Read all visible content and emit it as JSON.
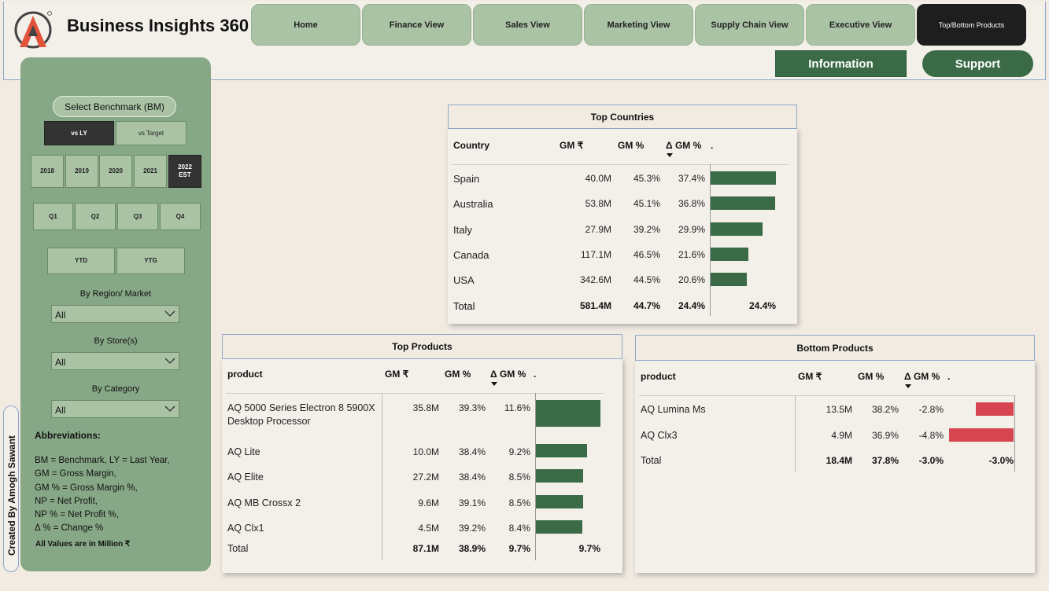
{
  "app": {
    "title": "Business Insights 360"
  },
  "nav": {
    "tabs": [
      {
        "label": "Home"
      },
      {
        "label": "Finance View"
      },
      {
        "label": "Sales View"
      },
      {
        "label": "Marketing View"
      },
      {
        "label": "Supply Chain View"
      },
      {
        "label": "Executive View"
      },
      {
        "label": "Top/Bottom Products"
      }
    ],
    "active_tab": "Top/Bottom Products"
  },
  "header_buttons": {
    "information": "Information",
    "support": "Support"
  },
  "sidebar": {
    "benchmark_label": "Select Benchmark (BM)",
    "benchmark_options": [
      "vs LY",
      "vs Target"
    ],
    "benchmark_selected": "vs LY",
    "years": [
      "2018",
      "2019",
      "2020",
      "2021",
      "2022 EST"
    ],
    "year_selected": "2022 EST",
    "quarters": [
      "Q1",
      "Q2",
      "Q3",
      "Q4"
    ],
    "periods": [
      "YTD",
      "YTG"
    ],
    "filters": [
      {
        "label": "By Region/ Market",
        "value": "All"
      },
      {
        "label": "By Store(s)",
        "value": "All"
      },
      {
        "label": "By Category",
        "value": "All"
      }
    ],
    "abbreviations_title": "Abbreviations:",
    "abbreviations": [
      "BM = Benchmark, LY = Last Year,",
      "GM = Gross Margin,",
      "GM % = Gross Margin %,",
      "NP = Net Profit,",
      "NP % = Net Profit %,",
      "Δ % = Change %"
    ],
    "values_note": "All Values are in Million ₹"
  },
  "created_by": "Created By Amogh Sawant",
  "top_countries": {
    "title": "Top Countries",
    "headers": [
      "Country",
      "GM ₹",
      "GM %",
      "Δ GM %",
      "."
    ],
    "rows": [
      {
        "name": "Spain",
        "gm": "40.0M",
        "gm_pct": "45.3%",
        "delta": "37.4%",
        "bar": 37.4
      },
      {
        "name": "Australia",
        "gm": "53.8M",
        "gm_pct": "45.1%",
        "delta": "36.8%",
        "bar": 36.8
      },
      {
        "name": "Italy",
        "gm": "27.9M",
        "gm_pct": "39.2%",
        "delta": "29.9%",
        "bar": 29.9
      },
      {
        "name": "Canada",
        "gm": "117.1M",
        "gm_pct": "46.5%",
        "delta": "21.6%",
        "bar": 21.6
      },
      {
        "name": "USA",
        "gm": "342.6M",
        "gm_pct": "44.5%",
        "delta": "20.6%",
        "bar": 20.6
      }
    ],
    "total": {
      "name": "Total",
      "gm": "581.4M",
      "gm_pct": "44.7%",
      "delta": "24.4%",
      "bar_label": "24.4%"
    }
  },
  "top_products": {
    "title": "Top Products",
    "headers": [
      "product",
      "GM ₹",
      "GM %",
      "Δ GM %",
      "."
    ],
    "rows": [
      {
        "name_line1": "AQ 5000 Series Electron 8 5900X",
        "name_line2": "Desktop Processor",
        "gm": "35.8M",
        "gm_pct": "39.3%",
        "delta": "11.6%",
        "bar": 11.6
      },
      {
        "name_line1": "AQ Lite",
        "name_line2": "",
        "gm": "10.0M",
        "gm_pct": "38.4%",
        "delta": "9.2%",
        "bar": 9.2
      },
      {
        "name_line1": "AQ Elite",
        "name_line2": "",
        "gm": "27.2M",
        "gm_pct": "38.4%",
        "delta": "8.5%",
        "bar": 8.5
      },
      {
        "name_line1": "AQ MB Crossx 2",
        "name_line2": "",
        "gm": "9.6M",
        "gm_pct": "39.1%",
        "delta": "8.5%",
        "bar": 8.5
      },
      {
        "name_line1": "AQ Clx1",
        "name_line2": "",
        "gm": "4.5M",
        "gm_pct": "39.2%",
        "delta": "8.4%",
        "bar": 8.4
      }
    ],
    "total": {
      "name": "Total",
      "gm": "87.1M",
      "gm_pct": "38.9%",
      "delta": "9.7%",
      "bar_label": "9.7%"
    }
  },
  "bottom_products": {
    "title": "Bottom Products",
    "headers": [
      "product",
      "GM ₹",
      "GM %",
      "Δ GM %",
      "."
    ],
    "rows": [
      {
        "name": "AQ Lumina Ms",
        "gm": "13.5M",
        "gm_pct": "38.2%",
        "delta": "-2.8%",
        "bar": -2.8
      },
      {
        "name": "AQ Clx3",
        "gm": "4.9M",
        "gm_pct": "36.9%",
        "delta": "-4.8%",
        "bar": -4.8
      }
    ],
    "total": {
      "name": "Total",
      "gm": "18.4M",
      "gm_pct": "37.8%",
      "delta": "-3.0%",
      "bar_label": "-3.0%"
    }
  },
  "colors": {
    "positive_bar": "#3a6b46",
    "negative_bar": "#d64550",
    "sidebar": "#87a886",
    "nav_tab": "#a9c3a4"
  }
}
